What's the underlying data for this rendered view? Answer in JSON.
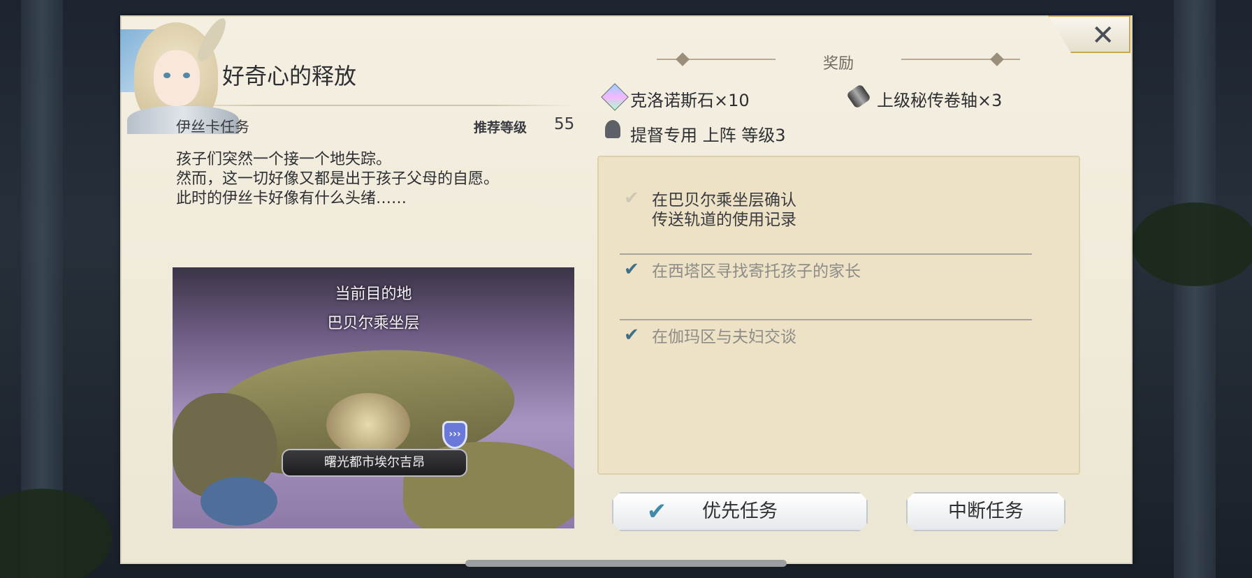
{
  "quest": {
    "title": "好奇心的释放",
    "category": "伊丝卡任务",
    "recommended_level_label": "推荐等级",
    "recommended_level_value": "55",
    "description_lines": [
      "孩子们突然一个接一个地失踪。",
      "然而，这一切好像又都是出于孩子父母的自愿。",
      "此时的伊丝卡好像有什么头绪……"
    ]
  },
  "map": {
    "destination_label": "当前目的地",
    "destination_name": "巴贝尔乘坐层",
    "city_label": "曙光都市埃尔吉昂",
    "pin_icon": "chevrons-icon"
  },
  "rewards": {
    "header": "奖励",
    "items": [
      {
        "icon": "crystal-icon",
        "label": "克洛诺斯石×10"
      },
      {
        "icon": "scroll-icon",
        "label": "上级秘传卷轴×3"
      },
      {
        "icon": "person-icon",
        "label": "提督专用 上阵 等级3"
      }
    ]
  },
  "objectives": [
    {
      "lines": [
        "在巴贝尔乘坐层确认",
        "传送轨道的使用记录"
      ],
      "status": "active"
    },
    {
      "lines": [
        "在西塔区寻找寄托孩子的家长"
      ],
      "status": "done"
    },
    {
      "lines": [
        "在伽玛区与夫妇交谈"
      ],
      "status": "done"
    }
  ],
  "buttons": {
    "priority": "优先任务",
    "abort": "中断任务",
    "close_icon": "close-icon"
  },
  "colors": {
    "panel": "#f0ebdc",
    "objective_box": "#ede2c5",
    "check_done": "#3f6f86",
    "gold_border": "#c9a84f"
  }
}
